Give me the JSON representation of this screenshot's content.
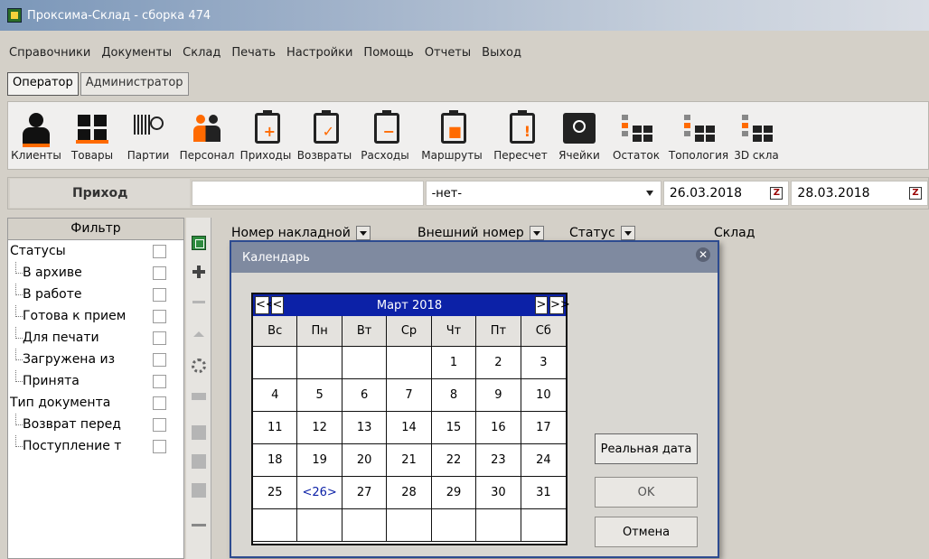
{
  "window": {
    "title": "Проксима-Склад - сборка 474"
  },
  "menu": [
    "Справочники",
    "Документы",
    "Склад",
    "Печать",
    "Настройки",
    "Помощь",
    "Отчеты",
    "Выход"
  ],
  "roles": {
    "operator": "Оператор",
    "admin": "Администратор"
  },
  "toolbar": [
    {
      "label": "Клиенты",
      "icon": "person-icon"
    },
    {
      "label": "Товары",
      "icon": "boxes-icon"
    },
    {
      "label": "Партии",
      "icon": "barcode-icon"
    },
    {
      "label": "Персонал",
      "icon": "people-icon"
    },
    {
      "label": "Приходы",
      "icon": "clipboard-plus-icon"
    },
    {
      "label": "Возвраты",
      "icon": "clipboard-check-icon"
    },
    {
      "label": "Расходы",
      "icon": "clipboard-minus-icon"
    },
    {
      "label": "Маршруты",
      "icon": "clipboard-truck-icon"
    },
    {
      "label": "Пересчет",
      "icon": "clipboard-alert-icon"
    },
    {
      "label": "Ячейки",
      "icon": "camera-icon"
    },
    {
      "label": "Остаток",
      "icon": "grid-icon"
    },
    {
      "label": "Топология",
      "icon": "topology-icon"
    },
    {
      "label": "3D скла",
      "icon": "cube-icon"
    }
  ],
  "docbar": {
    "title": "Приход",
    "status_value": "-нет-",
    "date_from": "26.03.2018",
    "date_to": "28.03.2018",
    "cal_icon_text": "Z"
  },
  "filter": {
    "header": "Фильтр",
    "rows": [
      {
        "label": "Статусы",
        "child": false
      },
      {
        "label": "В архиве",
        "child": true
      },
      {
        "label": "В работе",
        "child": true
      },
      {
        "label": "Готова к прием",
        "child": true
      },
      {
        "label": "Для печати",
        "child": true
      },
      {
        "label": "Загружена из",
        "child": true
      },
      {
        "label": "Принята",
        "child": true
      },
      {
        "label": "Тип документа",
        "child": false
      },
      {
        "label": "Возврат перед",
        "child": true
      },
      {
        "label": "Поступление т",
        "child": true
      }
    ]
  },
  "grid": {
    "columns": [
      "Номер накладной",
      "Внешний номер",
      "Статус",
      "Склад"
    ]
  },
  "calendar": {
    "title": "Календарь",
    "close_glyph": "✕",
    "month_label": "Март 2018",
    "nav": {
      "prev_year": "<<",
      "prev_month": "<",
      "next_month": ">",
      "next_year": ">>"
    },
    "weekdays": [
      "Вс",
      "Пн",
      "Вт",
      "Ср",
      "Чт",
      "Пт",
      "Сб"
    ],
    "weeks": [
      [
        "",
        "",
        "",
        "",
        "1",
        "2",
        "3"
      ],
      [
        "4",
        "5",
        "6",
        "7",
        "8",
        "9",
        "10"
      ],
      [
        "11",
        "12",
        "13",
        "14",
        "15",
        "16",
        "17"
      ],
      [
        "18",
        "19",
        "20",
        "21",
        "22",
        "23",
        "24"
      ],
      [
        "25",
        "<26>",
        "27",
        "28",
        "29",
        "30",
        "31"
      ],
      [
        "",
        "",
        "",
        "",
        "",
        "",
        ""
      ]
    ],
    "today_marker": "<26>",
    "buttons": {
      "real_date": "Реальная дата",
      "ok": "OK",
      "cancel": "Отмена"
    }
  }
}
